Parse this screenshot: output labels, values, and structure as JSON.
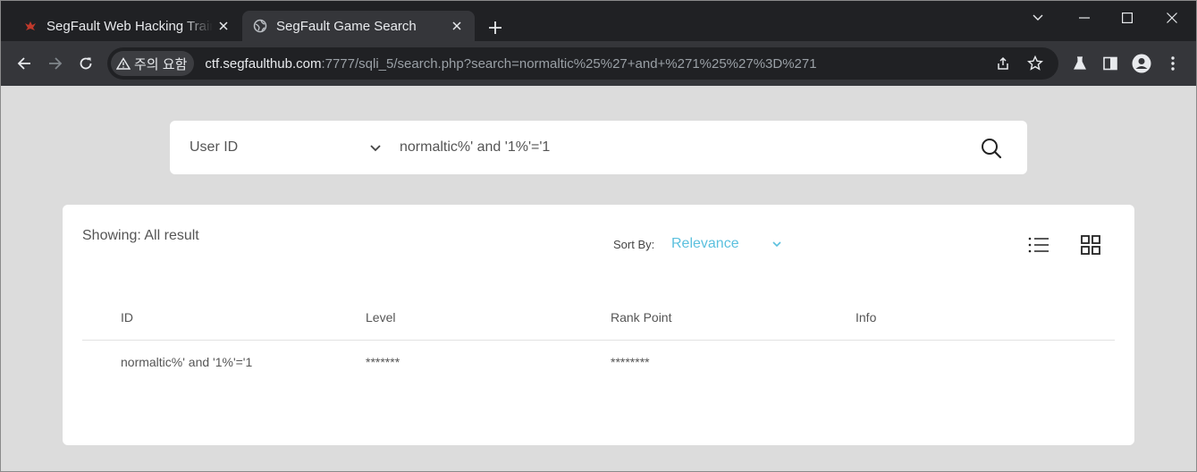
{
  "browser": {
    "tabs": [
      {
        "title": "SegFault Web Hacking Training",
        "favicon": "segfault-logo-icon",
        "active": false
      },
      {
        "title": "SegFault Game Search",
        "favicon": "globe-icon",
        "active": true
      }
    ],
    "security_label": "주의 요함",
    "url_host": "ctf.segfaulthub.com",
    "url_rest": ":7777/sqli_5/search.php?search=normaltic%25%27+and+%271%25%27%3D%271"
  },
  "search": {
    "field_label": "User ID",
    "query": "normaltic%' and '1%'='1"
  },
  "results": {
    "showing": "Showing: All result",
    "sort_label": "Sort By:",
    "sort_value": "Relevance",
    "columns": [
      "ID",
      "Level",
      "Rank Point",
      "Info"
    ],
    "rows": [
      {
        "id": "normaltic%' and '1%'='1",
        "level": "*******",
        "rank_point": "********",
        "info": ""
      }
    ]
  },
  "colors": {
    "chrome_dark": "#202124",
    "chrome_tab": "#35363a",
    "page_bg": "#dcdcdc",
    "accent": "#5bc0de"
  }
}
